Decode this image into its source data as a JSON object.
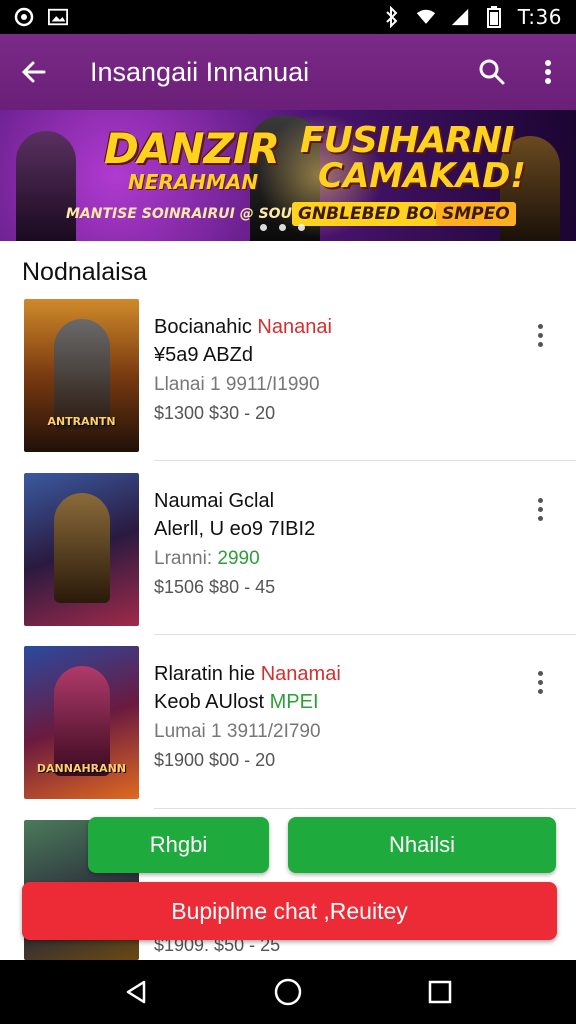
{
  "status_bar": {
    "time": "T:36"
  },
  "app_bar": {
    "title": "Insangaii Innanuai"
  },
  "banner": {
    "line_a": "DANZIR",
    "line_b": "FUSIHARNI",
    "line_c": "NERAHMAN",
    "line_d": "CAMAKAD!",
    "line_e": "MANTISE SOINRAIRUI @ SOUIAL HABE",
    "line_f": "GNBLEBED BONKAN",
    "line_g": "SMPEO"
  },
  "section": {
    "title": "Nodnalaisa"
  },
  "items": [
    {
      "title_a": "Bocianahic ",
      "title_b": "Nananai",
      "subtitle": "¥5a9 ABZd",
      "meta": "Llanai 1 9911/I1990",
      "meta_accent": "",
      "price": "$1300  $30 - 20",
      "thumb_caption": "ANTRANTN"
    },
    {
      "title_a": "Naumai Gclal",
      "title_b": "",
      "subtitle": "Alerll, U eo9 7IBI2",
      "meta": "Lranni: ",
      "meta_accent": "2990",
      "price": "$1506  $80 - 45",
      "thumb_caption": ""
    },
    {
      "title_a": "Rlaratin hie ",
      "title_b": "Nanamai",
      "subtitle_a": "Keob AUlost ",
      "subtitle_b": "MPEI",
      "meta": "Lumai 1 3911/2I790",
      "price": "$1900  $00 - 20",
      "thumb_caption": "DANNAHRANN"
    }
  ],
  "actions": {
    "green_left": "Rhgbi",
    "green_right": "Nhailsi",
    "red": "Bupiplme chat ,Reuitey"
  },
  "peek_price": "$1909. $50 - 25"
}
